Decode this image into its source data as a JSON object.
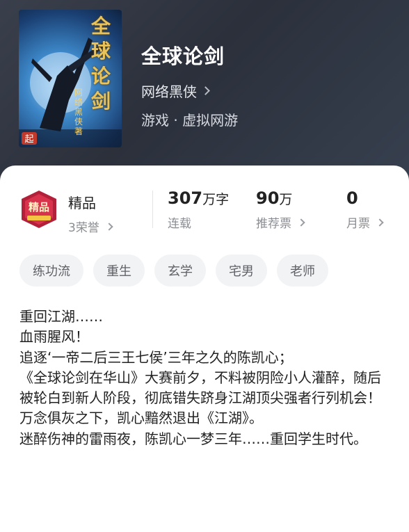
{
  "book": {
    "title": "全球论剑",
    "author": "网络黑侠",
    "genre": "游戏 · 虚拟网游",
    "cover_text": "全球论剑",
    "cover_author": "网络黑侠著"
  },
  "honor": {
    "title": "精品",
    "sub": "3荣誉",
    "badge_text": "精品"
  },
  "stats": [
    {
      "value": "307",
      "unit": "万字",
      "label": "连载"
    },
    {
      "value": "90",
      "unit": "万",
      "label": "推荐票"
    },
    {
      "value": "0",
      "unit": "",
      "label": "月票"
    }
  ],
  "tags": [
    "练功流",
    "重生",
    "玄学",
    "宅男",
    "老师"
  ],
  "description": [
    "重回江湖……",
    "血雨腥风！",
    "追逐‘一帝二后三王七侯’三年之久的陈凯心；",
    "《全球论剑在华山》大赛前夕，不料被阴险小人灌醉，随后被轮白到新人阶段，彻底错失跻身江湖顶尖强者行列机会！",
    "万念俱灰之下，凯心黯然退出《江湖》。",
    "迷醉伤神的雷雨夜，陈凯心一梦三年……重回学生时代。"
  ]
}
